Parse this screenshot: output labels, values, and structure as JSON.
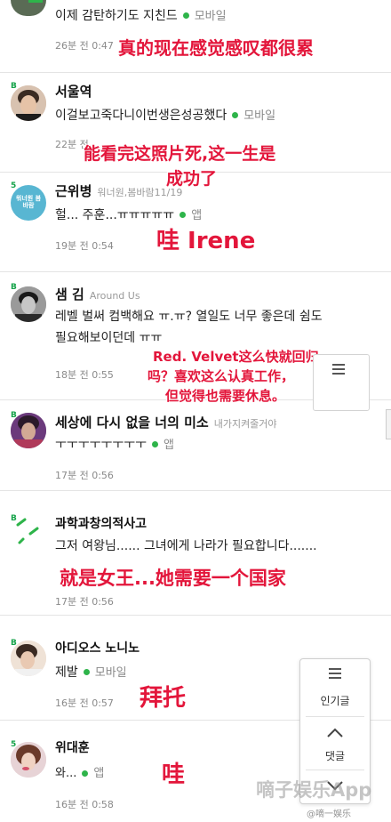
{
  "comments": [
    {
      "id": 1,
      "text": "이제 감탄하기도 지친드",
      "device": "모바일",
      "time": "26분 전 0:47",
      "overlay": "真的现在感觉感叹都很累"
    },
    {
      "id": 2,
      "name": "서울역",
      "text": "이걸보고죽다니이번생은성공했다",
      "device": "모바일",
      "time": "22분 전",
      "overlay_line1": "能看完这照片死,这一生是",
      "overlay_line2": "成功了"
    },
    {
      "id": 3,
      "name": "근위병",
      "sub": "워너원,봄바람11/19",
      "text": "헐... 주훈...ㅠㅠㅠㅠㅠ",
      "device": "앱",
      "time": "19분 전 0:54",
      "overlay": "哇 Irene"
    },
    {
      "id": 4,
      "name": "샘 김",
      "sub": "Around Us",
      "text_line1": "레벨 벌써 컴백해요 ㅠ.ㅠ? 열일도 너무 좋은데 쉼도",
      "text_line2": "필요해보이던데 ㅠㅠ",
      "time": "18분 전 0:55",
      "overlay_line1": "Red. Velvet这么快就回归",
      "overlay_line2": "吗？喜欢这么认真工作，",
      "overlay_line3": "但觉得也需要休息。"
    },
    {
      "id": 5,
      "name": "세상에 다시 없을 너의 미소",
      "sub": "내가지켜줄거야",
      "text": "ㅜㅜㅜㅜㅜㅜㅜㅜ",
      "device": "앱",
      "time": "17분 전 0:56"
    },
    {
      "id": 6,
      "name": "과학과창의적사고",
      "text": "그저 여왕님...... 그녀에게 나라가 필요합니다.......",
      "time": "17분 전 0:56",
      "overlay": "就是女王...她需要一个国家"
    },
    {
      "id": 7,
      "name": "아디오스 노니노",
      "text": "제발",
      "device": "모바일",
      "time": "16분 전 0:57",
      "overlay": "拜托"
    },
    {
      "id": 8,
      "name": "위대훈",
      "text": "와...",
      "device": "앱",
      "time": "16분 전 0:58",
      "overlay": "哇"
    }
  ],
  "level_badge": "B",
  "badge_5": "5",
  "avatar3_text": "워너원 봄바람",
  "float_menu": {
    "popular": "인기글",
    "comments": "댓글"
  },
  "watermark_main": "嘀子娱乐App",
  "watermark_weibo": "@嘀一娱乐"
}
